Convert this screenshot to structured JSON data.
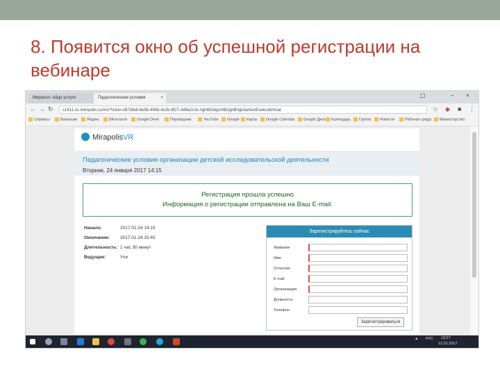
{
  "slide": {
    "title": "8. Появится окно об успешной регистрации на вебинаре"
  },
  "browser": {
    "tabs": [
      {
        "label": "Мирапол: Айди услуги"
      },
      {
        "label": "Педагогические условия"
      }
    ],
    "address": "s1411.vc-miropolis.ru/mv/?click=1B7dfe8-8e5b-490b-bc2b-8f27-4d9a2c3c-lightB2bigchtB2ghBrigistartionEsekcahrhcat",
    "bookmarks": [
      "Сервисы",
      "Вакансии",
      "Яндекс",
      "ВКонтакте",
      "Google Drive",
      "Переводчик",
      "YouTube",
      "Google",
      "Карты",
      "Google Calendar",
      "Google Диск",
      "Календарь",
      "Группа",
      "Новости",
      "Рабочая среда",
      "Министерство"
    ],
    "colors": {
      "accent": "#1e7fc1",
      "success": "#3aa55b",
      "header": "#2a8cb3"
    }
  },
  "page": {
    "logo_text": "Mirapolis",
    "logo_vr": "VR",
    "webinar_title": "Педагогические условия организации детской исследовательской деятельности",
    "date_line": "Вторник, 24 января 2017 14:15",
    "success_line1": "Регистрация прошла успешно",
    "success_line2": "Информация о регистрации отправлена на Ваш E-mail.",
    "info": [
      {
        "label": "Начало:",
        "value": "2017.01.24 14:15"
      },
      {
        "label": "Окончание:",
        "value": "2017.01.24 15:45"
      },
      {
        "label": "Длительность:",
        "value": "1 час 30 минут"
      },
      {
        "label": "Ведущие:",
        "value": "Учи"
      }
    ],
    "register_header": "Зарегистрируйтесь сейчас",
    "fields": [
      {
        "label": "Фамилия",
        "required": true
      },
      {
        "label": "Имя",
        "required": true
      },
      {
        "label": "Отчество",
        "required": true
      },
      {
        "label": "E-mail",
        "required": true
      },
      {
        "label": "Организация",
        "required": true
      },
      {
        "label": "Должность",
        "required": false
      },
      {
        "label": "Телефон",
        "required": false
      }
    ],
    "register_button": "Зарегистрироваться"
  },
  "taskbar": {
    "lang": "РУС",
    "time": "13:27",
    "date": "12.01.2017"
  }
}
